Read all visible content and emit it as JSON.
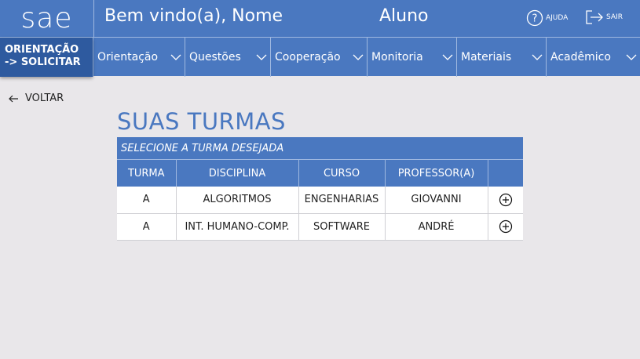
{
  "header": {
    "logo": "sae",
    "welcome": "Bem vindo(a), Nome",
    "role": "Aluno",
    "help_label": "AJUDA",
    "exit_label": "SAIR"
  },
  "nav": {
    "current_line1": "ORIENTAÇÃO",
    "current_line2": "-> SOLICITAR",
    "items": [
      {
        "label": "Orientação"
      },
      {
        "label": "Questões"
      },
      {
        "label": "Cooperação"
      },
      {
        "label": "Monitoria"
      },
      {
        "label": "Materiais"
      },
      {
        "label": "Acadêmico"
      }
    ]
  },
  "back_label": "VOLTAR",
  "page_title": "SUAS TURMAS",
  "table": {
    "caption": "SELECIONE A TURMA DESEJADA",
    "headers": [
      "TURMA",
      "DISCIPLINA",
      "CURSO",
      "PROFESSOR(A)",
      ""
    ],
    "rows": [
      {
        "turma": "A",
        "disciplina": "ALGORITMOS",
        "curso": "ENGENHARIAS",
        "professor": "GIOVANNI",
        "action_icon": "plus-circle-icon"
      },
      {
        "turma": "A",
        "disciplina": "INT. HUMANO-COMP.",
        "curso": "SOFTWARE",
        "professor": "ANDRÉ",
        "action_icon": "plus-circle-icon"
      }
    ]
  },
  "colors": {
    "primary": "#4a78c0",
    "primary_dark": "#2e5a9f",
    "background": "#e9e7ea"
  }
}
